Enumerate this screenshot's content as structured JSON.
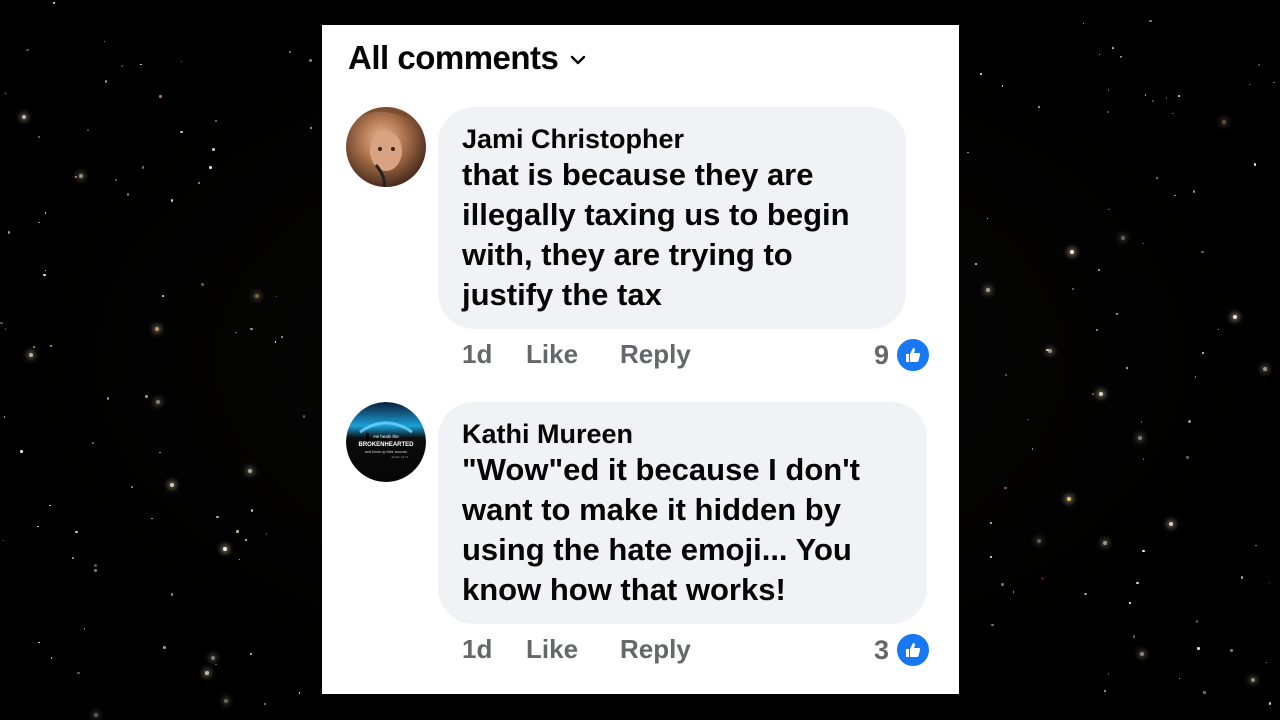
{
  "header": {
    "title": "All comments",
    "dropdown_icon": "chevron-down-icon"
  },
  "comments": [
    {
      "author": "Jami Christopher",
      "text": "that is because they are\nillegally taxing us to begin\nwith, they are trying to\njustify the tax",
      "time": "1d",
      "like_label": "Like",
      "reply_label": "Reply",
      "reaction_count": "9",
      "reaction_icon": "thumbs-up-icon"
    },
    {
      "author": "Kathi Mureen",
      "text": "\"Wow\"ed it because I don't\nwant to make it hidden by\nusing the hate emoji... You\nknow how that works!",
      "time": "1d",
      "like_label": "Like",
      "reply_label": "Reply",
      "reaction_count": "3",
      "reaction_icon": "thumbs-up-icon",
      "avatar_text": {
        "line1": "He heals the",
        "line2": "BROKENHEARTED",
        "line3": "and binds up their wounds",
        "line4": "Psalm 147:3"
      }
    }
  ],
  "colors": {
    "background": "#000000",
    "panel": "#ffffff",
    "bubble": "#f0f2f5",
    "secondary_text": "#65676b",
    "like_blue": "#1877f2"
  }
}
